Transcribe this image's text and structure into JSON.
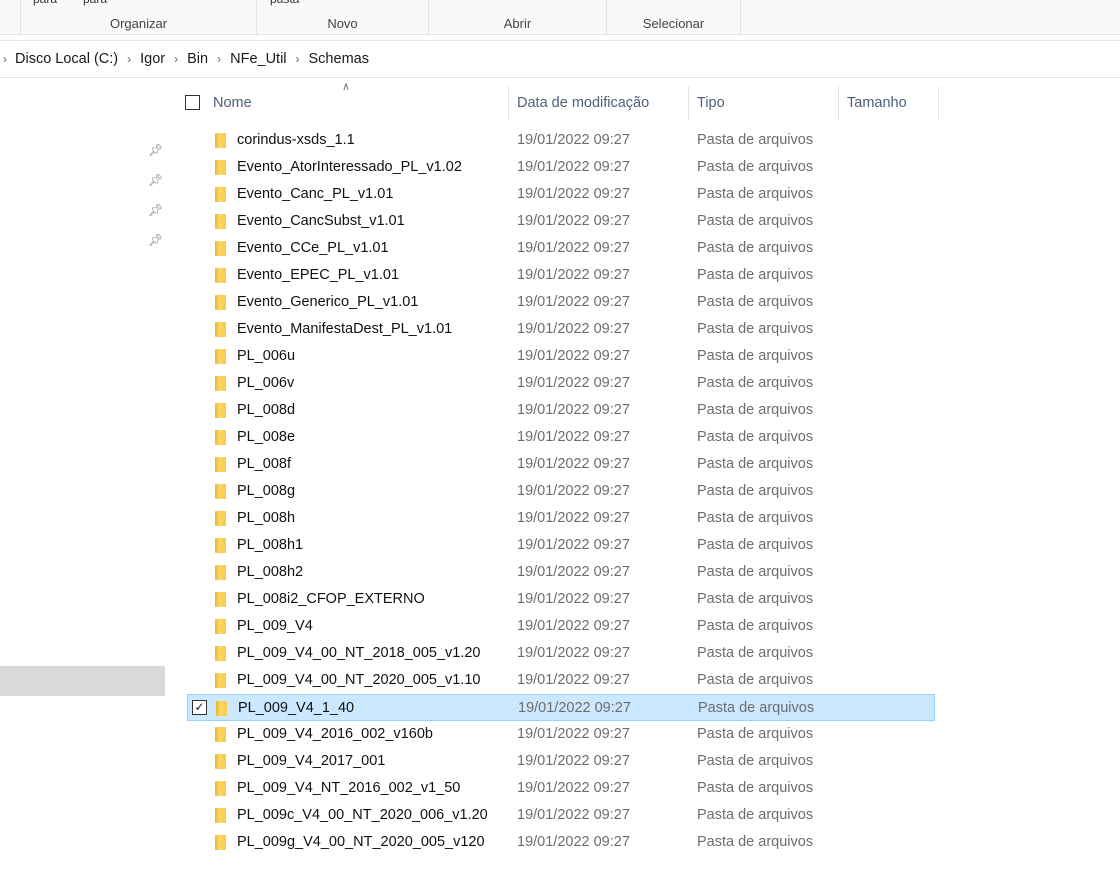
{
  "ribbon": {
    "groups": [
      {
        "caption": "Organizar",
        "top_labels": [
          "para",
          "para"
        ]
      },
      {
        "caption": "Novo",
        "top_labels": [
          "pasta"
        ]
      },
      {
        "caption": "Abrir"
      },
      {
        "caption": "Selecionar"
      }
    ]
  },
  "breadcrumb": [
    "Disco Local (C:)",
    "Igor",
    "Bin",
    "NFe_Util",
    "Schemas"
  ],
  "columns": {
    "name": "Nome",
    "date": "Data de modificação",
    "type": "Tipo",
    "size": "Tamanho"
  },
  "selected_index": 21,
  "files": [
    {
      "name": "corindus-xsds_1.1",
      "date": "19/01/2022 09:27",
      "type": "Pasta de arquivos"
    },
    {
      "name": "Evento_AtorInteressado_PL_v1.02",
      "date": "19/01/2022 09:27",
      "type": "Pasta de arquivos"
    },
    {
      "name": "Evento_Canc_PL_v1.01",
      "date": "19/01/2022 09:27",
      "type": "Pasta de arquivos"
    },
    {
      "name": "Evento_CancSubst_v1.01",
      "date": "19/01/2022 09:27",
      "type": "Pasta de arquivos"
    },
    {
      "name": "Evento_CCe_PL_v1.01",
      "date": "19/01/2022 09:27",
      "type": "Pasta de arquivos"
    },
    {
      "name": "Evento_EPEC_PL_v1.01",
      "date": "19/01/2022 09:27",
      "type": "Pasta de arquivos"
    },
    {
      "name": "Evento_Generico_PL_v1.01",
      "date": "19/01/2022 09:27",
      "type": "Pasta de arquivos"
    },
    {
      "name": "Evento_ManifestaDest_PL_v1.01",
      "date": "19/01/2022 09:27",
      "type": "Pasta de arquivos"
    },
    {
      "name": "PL_006u",
      "date": "19/01/2022 09:27",
      "type": "Pasta de arquivos"
    },
    {
      "name": "PL_006v",
      "date": "19/01/2022 09:27",
      "type": "Pasta de arquivos"
    },
    {
      "name": "PL_008d",
      "date": "19/01/2022 09:27",
      "type": "Pasta de arquivos"
    },
    {
      "name": "PL_008e",
      "date": "19/01/2022 09:27",
      "type": "Pasta de arquivos"
    },
    {
      "name": "PL_008f",
      "date": "19/01/2022 09:27",
      "type": "Pasta de arquivos"
    },
    {
      "name": "PL_008g",
      "date": "19/01/2022 09:27",
      "type": "Pasta de arquivos"
    },
    {
      "name": "PL_008h",
      "date": "19/01/2022 09:27",
      "type": "Pasta de arquivos"
    },
    {
      "name": "PL_008h1",
      "date": "19/01/2022 09:27",
      "type": "Pasta de arquivos"
    },
    {
      "name": "PL_008h2",
      "date": "19/01/2022 09:27",
      "type": "Pasta de arquivos"
    },
    {
      "name": "PL_008i2_CFOP_EXTERNO",
      "date": "19/01/2022 09:27",
      "type": "Pasta de arquivos"
    },
    {
      "name": "PL_009_V4",
      "date": "19/01/2022 09:27",
      "type": "Pasta de arquivos"
    },
    {
      "name": "PL_009_V4_00_NT_2018_005_v1.20",
      "date": "19/01/2022 09:27",
      "type": "Pasta de arquivos"
    },
    {
      "name": "PL_009_V4_00_NT_2020_005_v1.10",
      "date": "19/01/2022 09:27",
      "type": "Pasta de arquivos"
    },
    {
      "name": "PL_009_V4_1_40",
      "date": "19/01/2022 09:27",
      "type": "Pasta de arquivos"
    },
    {
      "name": "PL_009_V4_2016_002_v160b",
      "date": "19/01/2022 09:27",
      "type": "Pasta de arquivos"
    },
    {
      "name": "PL_009_V4_2017_001",
      "date": "19/01/2022 09:27",
      "type": "Pasta de arquivos"
    },
    {
      "name": "PL_009_V4_NT_2016_002_v1_50",
      "date": "19/01/2022 09:27",
      "type": "Pasta de arquivos"
    },
    {
      "name": "PL_009c_V4_00_NT_2020_006_v1.20",
      "date": "19/01/2022 09:27",
      "type": "Pasta de arquivos"
    },
    {
      "name": "PL_009g_V4_00_NT_2020_005_v120",
      "date": "19/01/2022 09:27",
      "type": "Pasta de arquivos"
    }
  ]
}
